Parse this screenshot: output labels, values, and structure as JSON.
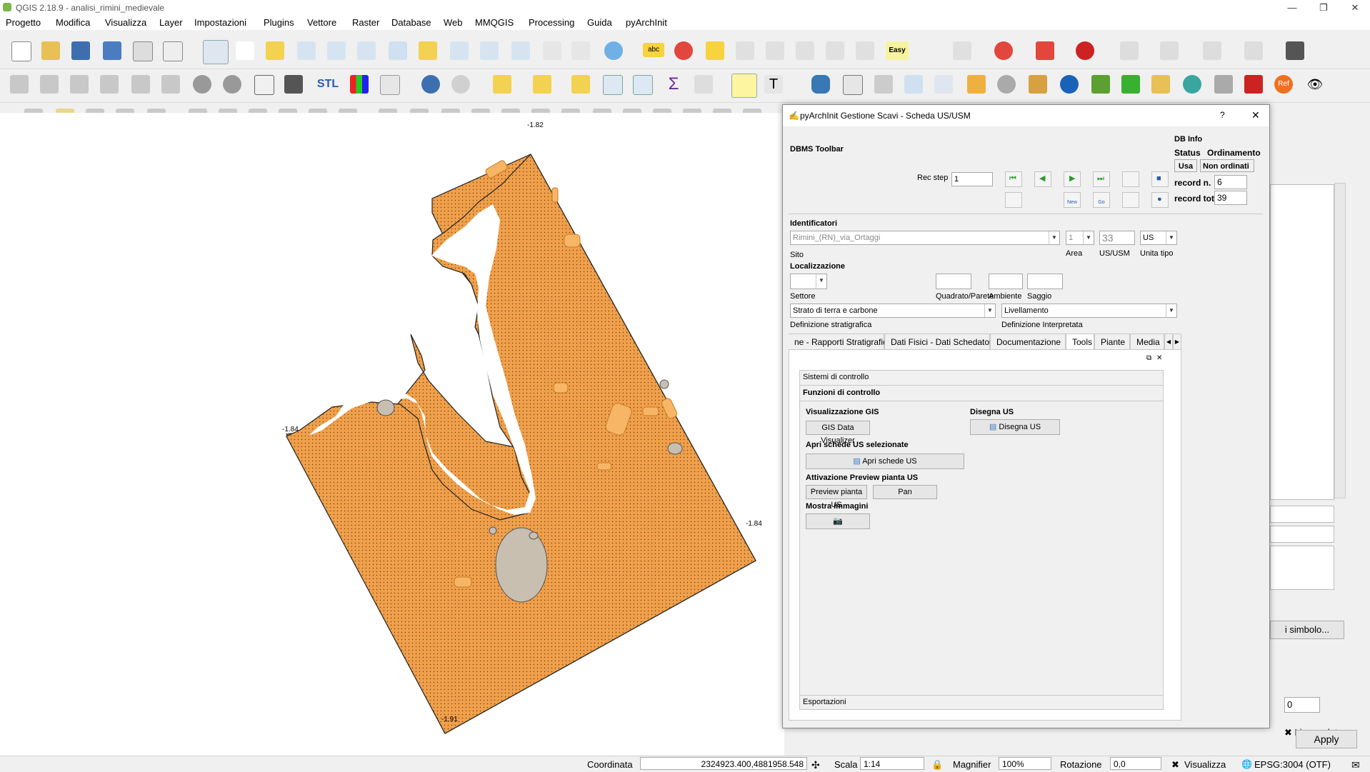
{
  "window": {
    "title": "QGIS 2.18.9 - analisi_rimini_medievale"
  },
  "menu": [
    "Progetto",
    "Modifica",
    "Visualizza",
    "Layer",
    "Impostazioni",
    "Plugins",
    "Vettore",
    "Raster",
    "Database",
    "Web",
    "MMQGIS",
    "Processing",
    "Guida",
    "pyArchInit"
  ],
  "toolbar": {
    "stl_label": "STL",
    "ref_label": "Ref",
    "easy_label": "Easy"
  },
  "map": {
    "labels": [
      "-1.82",
      "-1.84",
      "-1.84",
      "-1.91"
    ],
    "polygon_color": "#f0a04b",
    "feature_color": "#c8bfb0"
  },
  "dialog": {
    "title": "pyArchInit Gestione Scavi - Scheda US/USM",
    "help": "?",
    "close": "✕",
    "dbms_toolbar": "DBMS Toolbar",
    "rec_step_label": "Rec step",
    "rec_step_value": "1",
    "db_info": "DB Info",
    "status_label": "Status",
    "ordinamento_label": "Ordinamento",
    "status_value": "Usa",
    "ordinamento_value": "Non ordinati",
    "record_n_label": "record n.",
    "record_n_value": "6",
    "record_tot_label": "record tot.",
    "record_tot_value": "39",
    "nav_new": "New",
    "nav_go": "Go",
    "identificatori": "Identificatori",
    "sito_value": "Rimini_(RN)_via_Ortaggi",
    "sito_label": "Sito",
    "area_value": "1",
    "area_label": "Area",
    "us_value": "33",
    "us_label": "US/USM",
    "unita_value": "US",
    "unita_label": "Unita tipo",
    "localizzazione": "Localizzazione",
    "settore_label": "Settore",
    "quadrato_label": "Quadrato/Parete",
    "ambiente_label": "Ambiente",
    "saggio_label": "Saggio",
    "def_strat_value": "Strato di terra e carbone",
    "def_strat_label": "Definizione stratigrafica",
    "def_interp_value": "Livellamento",
    "def_interp_label": "Definizione Interpretata",
    "tabs": [
      "ne - Rapporti Stratigrafici",
      "Dati Fisici - Dati Schedatore",
      "Documentazione",
      "Tools",
      "Piante",
      "Media"
    ],
    "sistemi_controllo": "Sistemi di controllo",
    "funzioni_controllo": "Funzioni di controllo",
    "vis_gis": "Visualizzazione GIS",
    "gis_data_visualizer": "GIS Data Visualizer",
    "disegna_us_title": "Disegna US",
    "disegna_us_btn": "Disegna US",
    "apri_schede_title": "Apri schede US selezionate",
    "apri_schede_btn": "Apri schede US",
    "preview_title": "Attivazione Preview pianta US",
    "preview_btn": "Preview pianta US",
    "pan_btn": "Pan",
    "mostra_immagini": "Mostra immagini",
    "esportazioni": "Esportazioni"
  },
  "right_panel": {
    "simbolo_btn": "i simbolo...",
    "spin_value": "0",
    "live_update": "Live update",
    "apply": "Apply"
  },
  "statusbar": {
    "coordinata_label": "Coordinata",
    "coordinata_value": "2324923.400,4881958.548",
    "scala_label": "Scala",
    "scala_value": "1:14",
    "magnifier_label": "Magnifier",
    "magnifier_value": "100%",
    "rotazione_label": "Rotazione",
    "rotazione_value": "0,0",
    "visualizza_label": "Visualizza",
    "epsg": "EPSG:3004 (OTF)"
  }
}
